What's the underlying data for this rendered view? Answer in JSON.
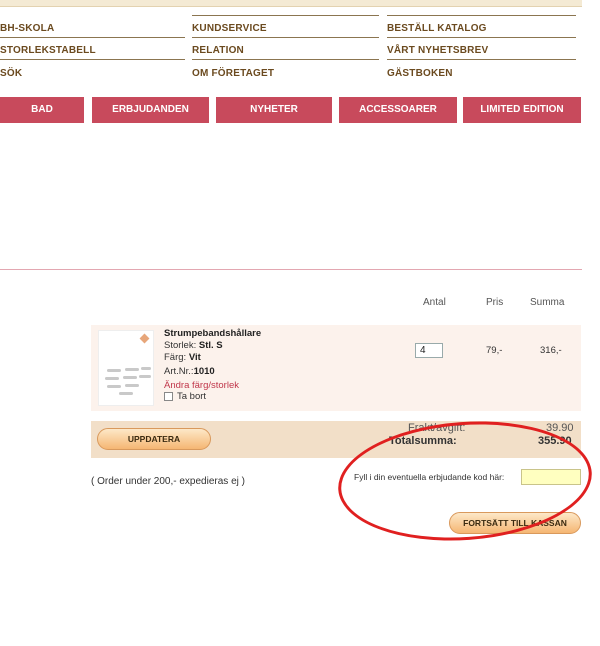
{
  "top_links": {
    "col1": [
      "BH-SKOLA",
      "STORLEKSTABELL",
      "SÖK"
    ],
    "col2": [
      "KUNDSERVICE",
      "RELATION",
      "OM FÖRETAGET"
    ],
    "col3": [
      "BESTÄLL KATALOG",
      "VÅRT NYHETSBREV",
      "GÄSTBOKEN"
    ]
  },
  "nav": [
    "BAD",
    "ERBJUDANDEN",
    "NYHETER",
    "ACCESSOARER",
    "LIMITED EDITION"
  ],
  "cart": {
    "headers": {
      "antal": "Antal",
      "pris": "Pris",
      "summa": "Summa"
    },
    "item": {
      "name": "Strumpebandshållare",
      "size_label": "Storlek:",
      "size_value": "Stl. S",
      "color_label": "Färg:",
      "color_value": "Vit",
      "art_label": "Art.Nr.:",
      "art_value": "1010",
      "change_link": "Ändra färg/storlek",
      "remove_label": "Ta bort",
      "quantity": "4",
      "price": "79,-",
      "sum": "316,-"
    },
    "update_button": "UPPDATERA",
    "shipping_label": "Frakt/avgift:",
    "shipping_value": "39.90",
    "total_label": "Totalsumma:",
    "total_value": "355.90",
    "order_note": "( Order under 200,- expedieras ej )",
    "code_label": "Fyll i din eventuella erbjudande kod här:",
    "code_value": "",
    "checkout_button": "FORTSÄTT TILL KASSAN"
  },
  "colors": {
    "nav_bg": "#c84a5c",
    "highlight": "#e02020",
    "button_orange": "#f5b673"
  }
}
